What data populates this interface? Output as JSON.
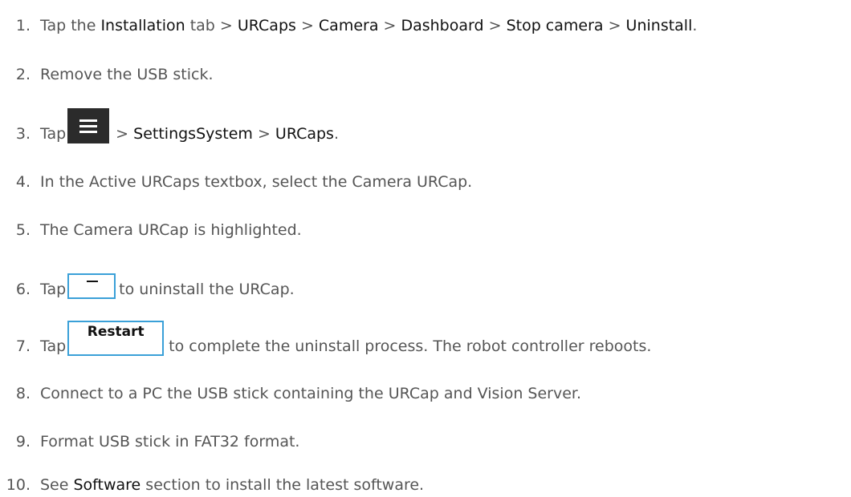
{
  "steps": [
    {
      "num": "1.",
      "t1": "Tap the ",
      "b1": "Installation",
      "t2": " tab > ",
      "b2": "URCaps",
      "t3": " > ",
      "b3": "Camera",
      "t4": " > ",
      "b4": "Dashboard",
      "t5": " > ",
      "b5": "Stop camera",
      "t6": " > ",
      "b6": "Uninstall",
      "t7": "."
    },
    {
      "num": "2.",
      "text": "Remove the USB stick."
    },
    {
      "num": "3.",
      "t1": "Tap",
      "menu_icon": "hamburger-menu-icon",
      "t2": " > ",
      "b1": "SettingsSystem",
      "t3": " > ",
      "b2": "URCaps",
      "t4": "."
    },
    {
      "num": "4.",
      "text": "In the Active URCaps textbox, select the Camera URCap."
    },
    {
      "num": "5.",
      "text": "The Camera URCap is highlighted."
    },
    {
      "num": "6.",
      "t1": "Tap",
      "button_icon": "minus-icon",
      "t2": "to uninstall the URCap."
    },
    {
      "num": "7.",
      "t1": "Tap",
      "button_label": "Restart",
      "t2": "to complete the uninstall process. The robot controller reboots."
    },
    {
      "num": "8.",
      "text": "Connect to a PC the USB stick containing the URCap and Vision Server."
    },
    {
      "num": "9.",
      "text": "Format USB stick in FAT32 format."
    },
    {
      "num": "10.",
      "t1": "See ",
      "b1": "Software",
      "t2": " section to install the latest software."
    }
  ],
  "colors": {
    "text": "#555555",
    "emphasis": "#111111",
    "button_border": "#3aa0d8",
    "menu_button": "#2b2b2b"
  }
}
